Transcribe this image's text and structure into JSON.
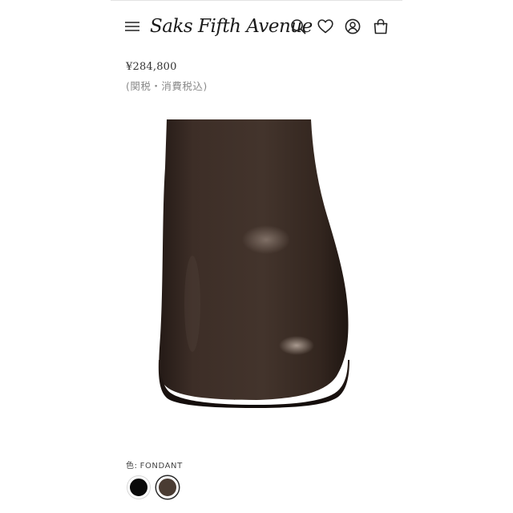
{
  "header": {
    "menu_icon": "hamburger-menu-icon",
    "logo_text": "Saks Fifth Avenue",
    "search_icon": "search-icon",
    "wishlist_icon": "heart-icon",
    "account_icon": "user-account-icon",
    "bag_icon": "shopping-bag-icon"
  },
  "product": {
    "price": "¥284,800",
    "tax_note": "(関税・消費税込)",
    "image_alt": "dark brown leather square-toe boot"
  },
  "color": {
    "label_prefix": "色",
    "label_sep": ":",
    "selected_name": "FONDANT",
    "swatches": [
      {
        "name": "black",
        "hex": "#0a0a0a",
        "selected": false
      },
      {
        "name": "FONDANT",
        "hex": "#4a3c33",
        "selected": true
      }
    ]
  },
  "colors": {
    "boot_leather": "#3b2c26",
    "text": "#333333",
    "muted_text": "#8a8a8a"
  }
}
